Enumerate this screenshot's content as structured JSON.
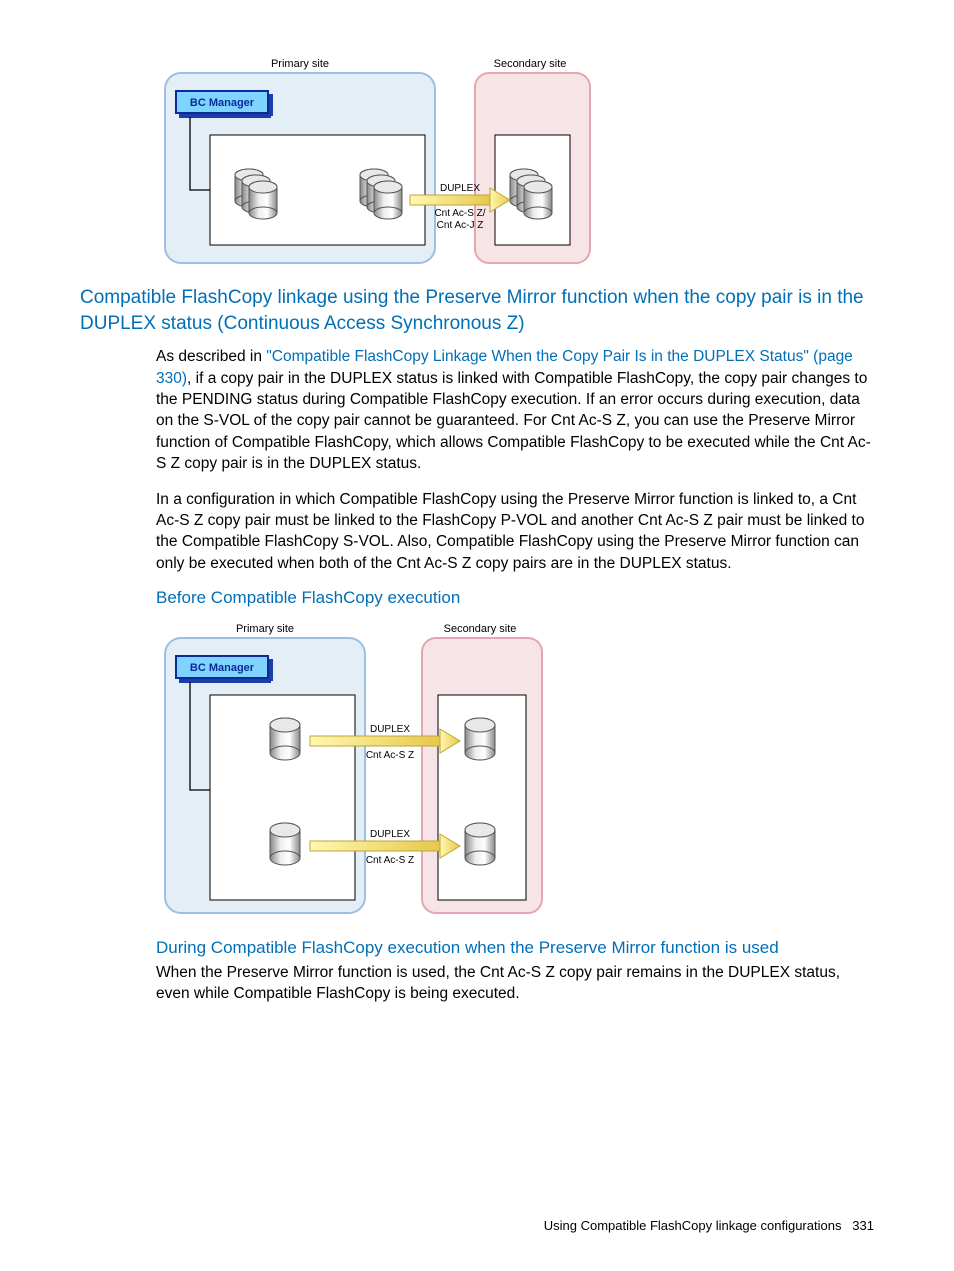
{
  "fig1": {
    "primary_label": "Primary site",
    "secondary_label": "Secondary site",
    "bc_label": "BC Manager",
    "arrow_top": "DUPLEX",
    "arrow_mid": "Cnt Ac-S Z/",
    "arrow_bot": "Cnt Ac-J Z"
  },
  "section_heading": "Compatible FlashCopy linkage using the Preserve Mirror function when the copy pair is in the DUPLEX status (Continuous Access Synchronous Z)",
  "para1_pre": "As described in ",
  "para1_link": "\"Compatible FlashCopy Linkage When the Copy Pair Is in the DUPLEX Status\" (page 330)",
  "para1_post": ", if a copy pair in the DUPLEX status is linked with Compatible FlashCopy, the copy pair changes to the PENDING status during Compatible FlashCopy execution. If an error occurs during execution, data on the S-VOL of the copy pair cannot be guaranteed. For Cnt Ac-S Z, you can use the Preserve Mirror function of Compatible FlashCopy, which allows Compatible FlashCopy to be executed while the Cnt Ac-S Z copy pair is in the DUPLEX status.",
  "para2": "In a configuration in which Compatible FlashCopy using the Preserve Mirror function is linked to, a Cnt Ac-S Z copy pair must be linked to the FlashCopy P-VOL and another Cnt Ac-S Z pair must be linked to the Compatible FlashCopy S-VOL. Also, Compatible FlashCopy using the Preserve Mirror function can only be executed when both of the Cnt Ac-S Z copy pairs are in the DUPLEX status.",
  "sub1": "Before Compatible FlashCopy execution",
  "fig2": {
    "primary_label": "Primary site",
    "secondary_label": "Secondary site",
    "bc_label": "BC Manager",
    "a1_top": "DUPLEX",
    "a1_bot": "Cnt Ac-S Z",
    "a2_top": "DUPLEX",
    "a2_bot": "Cnt Ac-S Z"
  },
  "sub2": "During Compatible FlashCopy execution when the Preserve Mirror function is used",
  "para3": "When the Preserve Mirror function is used, the Cnt Ac-S Z copy pair remains in the DUPLEX status, even while Compatible FlashCopy is being executed.",
  "footer_text": "Using Compatible FlashCopy linkage configurations",
  "footer_page": "331"
}
